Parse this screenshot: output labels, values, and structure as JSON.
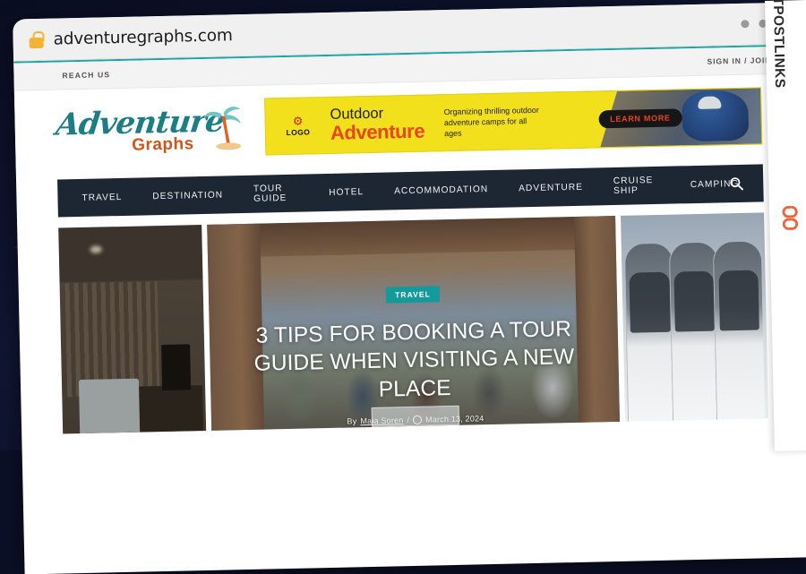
{
  "browser": {
    "url": "adventuregraphs.com",
    "lock_icon": "lock-icon",
    "window_dots": [
      "dot",
      "dot",
      "dot"
    ]
  },
  "topbar": {
    "reach_us": "REACH US",
    "sign_in": "SIGN IN / JOIN"
  },
  "site": {
    "logo_primary": "Adventure",
    "logo_secondary": "Graphs",
    "palm_icon": "palm-tree-icon"
  },
  "ad": {
    "logo_label": "LOGO",
    "gear_icon": "gear-icon",
    "title_line1": "Outdoor",
    "title_line2": "Adventure",
    "tagline": "Organizing thrilling outdoor adventure camps for all ages",
    "cta": "LEARN MORE"
  },
  "nav": {
    "items": [
      {
        "label": "TRAVEL"
      },
      {
        "label": "DESTINATION"
      },
      {
        "label": "TOUR GUIDE"
      },
      {
        "label": "HOTEL"
      },
      {
        "label": "ACCOMMODATION"
      },
      {
        "label": "ADVENTURE"
      },
      {
        "label": "CRUISE SHIP"
      },
      {
        "label": "CAMPING"
      }
    ],
    "search_icon": "search-icon"
  },
  "hero": {
    "category_badge": "TRAVEL",
    "title": "3 TIPS FOR BOOKING A TOUR GUIDE WHEN VISITING A NEW PLACE",
    "by_prefix": "By",
    "author": "Maia Soren",
    "separator": "/",
    "clock_icon": "clock-icon",
    "date": "March 13, 2024"
  },
  "thumbnails": [
    {
      "name": "hotel-room-thumbnail"
    },
    {
      "name": "tour-bus-thumbnail"
    }
  ],
  "brand_strip": {
    "text": "GUESTPOSTLINKS",
    "logo_icon": "chain-link-icon"
  },
  "colors": {
    "teal": "#1aa5a5",
    "badge_teal": "#149a9a",
    "nav_dark": "#1d2733",
    "ad_yellow": "#f2e01c",
    "ad_red": "#e8451f",
    "logo_teal": "#1d7d84",
    "logo_orange": "#d2541c",
    "brand_orange": "#ef6337",
    "backdrop": "#0c1027"
  }
}
